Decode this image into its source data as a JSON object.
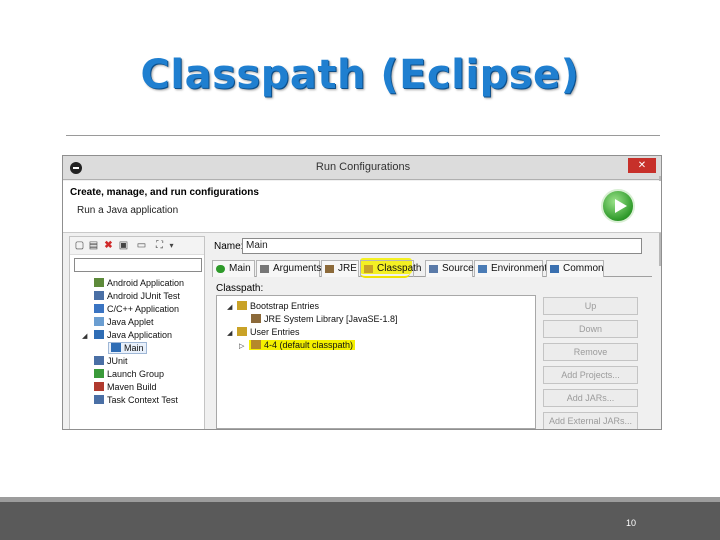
{
  "slide": {
    "title": "Classpath (Eclipse)",
    "page_number": "10"
  },
  "window": {
    "title": "Run Configurations",
    "close_label": "✕",
    "header_title": "Create, manage, and run configurations",
    "header_subtitle": "Run a Java application"
  },
  "left_tree": {
    "items": [
      {
        "label": "Android Application",
        "icon": "android-app-icon"
      },
      {
        "label": "Android JUnit Test",
        "icon": "junit-icon"
      },
      {
        "label": "C/C++ Application",
        "icon": "c-app-icon"
      },
      {
        "label": "Java Applet",
        "icon": "applet-icon"
      },
      {
        "label": "Java Application",
        "icon": "java-app-icon"
      },
      {
        "label": "Main",
        "icon": "java-config-icon"
      },
      {
        "label": "JUnit",
        "icon": "junit-icon"
      },
      {
        "label": "Launch Group",
        "icon": "launch-group-icon"
      },
      {
        "label": "Maven Build",
        "icon": "maven-icon"
      },
      {
        "label": "Task Context Test",
        "icon": "task-context-icon"
      }
    ]
  },
  "config": {
    "name_label": "Name:",
    "name_value": "Main",
    "tabs": [
      "Main",
      "Arguments",
      "JRE",
      "Classpath",
      "Source",
      "Environment",
      "Common"
    ],
    "active_tab": "Classpath",
    "classpath_label": "Classpath:",
    "classpath_tree": [
      {
        "label": "Bootstrap Entries"
      },
      {
        "label": "JRE System Library [JavaSE-1.8]"
      },
      {
        "label": "User Entries"
      },
      {
        "label": "4-4 (default classpath)"
      }
    ],
    "buttons": [
      "Up",
      "Down",
      "Remove",
      "Add Projects...",
      "Add JARs...",
      "Add External JARs..."
    ]
  },
  "colors": {
    "title_blue": "#1f7fd0",
    "highlight_yellow": "#f4f000",
    "run_green": "#2e9a2a",
    "close_red": "#c7302a"
  }
}
